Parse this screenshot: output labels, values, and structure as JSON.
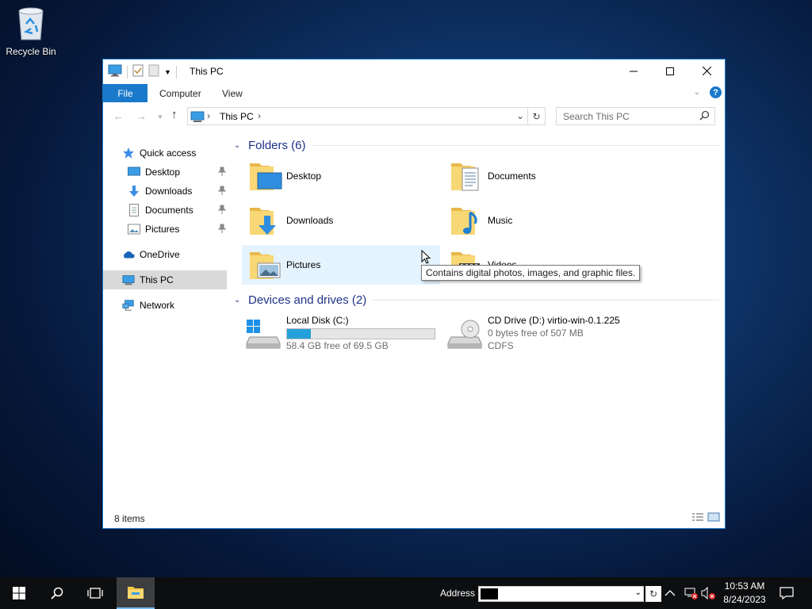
{
  "desktop": {
    "recycle_bin_label": "Recycle Bin"
  },
  "window": {
    "title": "This PC",
    "ribbon": {
      "file_tab": "File",
      "tabs": [
        "Computer",
        "View"
      ]
    },
    "address": {
      "crumb": "This PC"
    },
    "search": {
      "placeholder": "Search This PC"
    },
    "sidebar": {
      "quick_access": "Quick access",
      "pinned": [
        "Desktop",
        "Downloads",
        "Documents",
        "Pictures"
      ],
      "onedrive": "OneDrive",
      "this_pc": "This PC",
      "network": "Network"
    },
    "folders_header": "Folders (6)",
    "folders": [
      "Desktop",
      "Documents",
      "Downloads",
      "Music",
      "Pictures",
      "Videos"
    ],
    "drives_header": "Devices and drives (2)",
    "drives": [
      {
        "name": "Local Disk (C:)",
        "info": "58.4 GB free of 69.5 GB",
        "used_fraction": 0.16
      },
      {
        "name": "CD Drive (D:) virtio-win-0.1.225",
        "info": "0 bytes free of 507 MB",
        "fs": "CDFS"
      }
    ],
    "tooltip": "Contains digital photos, images, and graphic files.",
    "status": {
      "count": "8 items"
    }
  },
  "taskbar": {
    "address_label": "Address",
    "time": "10:53 AM",
    "date": "8/24/2023"
  },
  "colors": {
    "accent": "#1979ca",
    "folder": "#f8d775",
    "progress": "#26a0da"
  }
}
